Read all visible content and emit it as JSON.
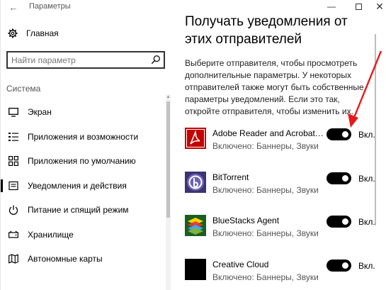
{
  "window": {
    "title": "Параметры",
    "back_glyph": "←",
    "min_glyph": "—",
    "close_glyph": "✕"
  },
  "sidebar": {
    "home_label": "Главная",
    "search_placeholder": "Найти параметр",
    "section_label": "Система",
    "items": [
      {
        "label": "Экран",
        "icon": "monitor-icon"
      },
      {
        "label": "Приложения и возможности",
        "icon": "apps-list-icon"
      },
      {
        "label": "Приложения по умолчанию",
        "icon": "default-apps-icon"
      },
      {
        "label": "Уведомления и действия",
        "icon": "notifications-icon",
        "active": true
      },
      {
        "label": "Питание и спящий режим",
        "icon": "power-icon"
      },
      {
        "label": "Хранилище",
        "icon": "storage-icon"
      },
      {
        "label": "Автономные карты",
        "icon": "offline-maps-icon"
      }
    ]
  },
  "main": {
    "heading": "Получать уведомления от этих отправителей",
    "description": "Выберите отправителя, чтобы просмотреть дополнительные параметры. У некоторых отправителей также могут быть собственные параметры уведомлений. Если это так, откройте отправителя, чтобы изменить их.",
    "apps": [
      {
        "name": "Adobe Reader and Acrobat Manager",
        "status": "Включено: Баннеры, Звуки",
        "toggle_on": true,
        "toggle_label": "Вкл.",
        "icon": "adobe-reader-icon",
        "icon_color": "#cc0000"
      },
      {
        "name": "BitTorrent",
        "status": "Включено: Баннеры, Звуки",
        "toggle_on": true,
        "toggle_label": "Вкл.",
        "icon": "bittorrent-icon",
        "icon_color": "#5a4e9a"
      },
      {
        "name": "BlueStacks Agent",
        "status": "Включено: Баннеры, Звуки",
        "toggle_on": true,
        "toggle_label": "Вкл.",
        "icon": "bluestacks-icon",
        "icon_color": "#2e7d32"
      },
      {
        "name": "Creative Cloud",
        "status": "Включено: Баннеры, Звуки",
        "toggle_on": true,
        "toggle_label": "Вкл.",
        "icon": "creative-cloud-icon",
        "icon_color": "#000000"
      }
    ]
  },
  "annotation": {
    "arrow_color": "#e51b1b"
  }
}
